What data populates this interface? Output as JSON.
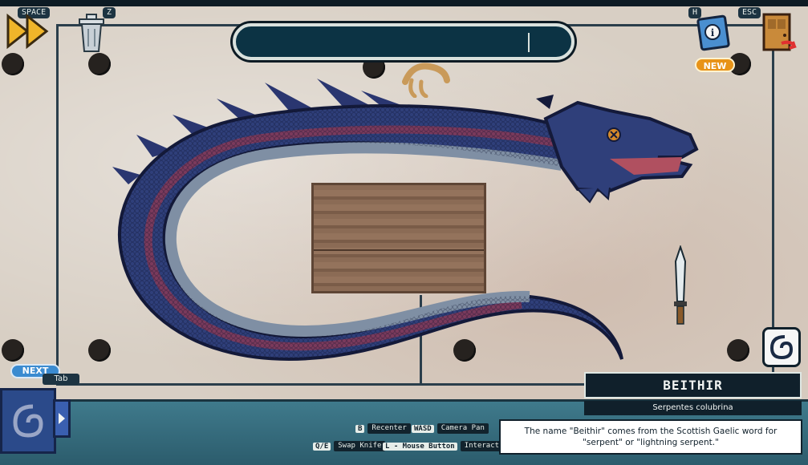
{
  "hud": {
    "fast_forward_key": "SPACE",
    "trash_key": "Z",
    "help_key": "H",
    "exit_key": "ESC",
    "new_badge": "NEW",
    "next_label": "NEXT",
    "next_key": "Tab"
  },
  "search": {
    "value": ""
  },
  "controls": [
    {
      "key": "B",
      "action": "Recenter"
    },
    {
      "key": "WASD",
      "action": "Camera Pan"
    },
    {
      "key": "Q/E",
      "action": "Swap Knife"
    },
    {
      "key": "L - Mouse Button",
      "action": "Interact"
    }
  ],
  "creature": {
    "name": "BEITHIR",
    "scientific_name": "Serpentes colubrina",
    "description": "The name \"Beithir\" comes from the Scottish Gaelic word for \"serpent\" or \"lightning serpent.\""
  },
  "colors": {
    "serpent_body": "#2f3f7a",
    "serpent_stripe": "#7a3a5c",
    "serpent_belly": "#7f8fa4",
    "panel_dark": "#10202b",
    "new_badge": "#e89318",
    "next_badge": "#3b8bd0"
  },
  "icons": [
    "fast-forward-icon",
    "trash-can-icon",
    "help-book-icon",
    "exit-door-icon",
    "spiral-icon",
    "knife-icon",
    "journal-spiral-icon",
    "chevron-right-icon"
  ]
}
